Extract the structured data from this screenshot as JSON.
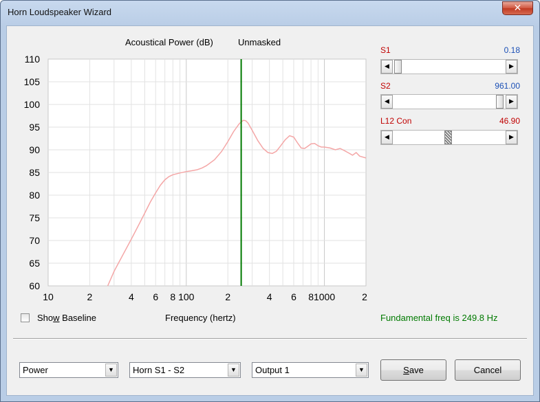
{
  "window": {
    "title": "Horn Loudspeaker Wizard",
    "close_glyph": "✕"
  },
  "chart_title": "Acoustical Power (dB)",
  "chart_mode": "Unmasked",
  "sliders": [
    {
      "label": "S1",
      "value": "0.18",
      "value_color": "#1a4fb5",
      "position": 0.02
    },
    {
      "label": "S2",
      "value": "961.00",
      "value_color": "#1a4fb5",
      "position": 0.98
    },
    {
      "label": "L12  Con",
      "value": "46.90",
      "value_color": "#c00000",
      "position": 0.47
    }
  ],
  "show_baseline": {
    "label_pre": "Sho",
    "label_underlined": "w",
    "label_post": " Baseline",
    "checked": false
  },
  "fundamental_text": "Fundamental freq is 249.8 Hz",
  "dropdowns": [
    {
      "name": "type",
      "selected": "Power"
    },
    {
      "name": "section",
      "selected": "Horn S1 - S2"
    },
    {
      "name": "output",
      "selected": "Output 1"
    }
  ],
  "buttons": {
    "save_pre": "",
    "save_underlined": "S",
    "save_post": "ave",
    "cancel": "Cancel"
  },
  "chart_data": {
    "type": "line",
    "title": "Acoustical Power (dB)   Unmasked",
    "xlabel": "Frequency (hertz)",
    "ylabel": "",
    "x_scale": "log",
    "xlim": [
      10,
      2000
    ],
    "ylim": [
      60,
      110
    ],
    "y_ticks": [
      110,
      105,
      100,
      95,
      90,
      85,
      80,
      75,
      70,
      65,
      60
    ],
    "x_ticks": [
      {
        "value": 10,
        "label": "10"
      },
      {
        "value": 20,
        "label": "2"
      },
      {
        "value": 40,
        "label": "4"
      },
      {
        "value": 60,
        "label": "6"
      },
      {
        "value": 80,
        "label": "8"
      },
      {
        "value": 100,
        "label": "100"
      },
      {
        "value": 200,
        "label": "2"
      },
      {
        "value": 400,
        "label": "4"
      },
      {
        "value": 600,
        "label": "6"
      },
      {
        "value": 800,
        "label": "8"
      },
      {
        "value": 1000,
        "label": "1000"
      },
      {
        "value": 2000,
        "label": "2"
      }
    ],
    "grid": true,
    "marker_frequency": 249.8,
    "marker_color": "#007a00",
    "series": [
      {
        "color": "#f4a6a6",
        "x": [
          27,
          30,
          35,
          40,
          45,
          50,
          55,
          60,
          65,
          70,
          75,
          80,
          90,
          100,
          110,
          120,
          130,
          140,
          160,
          180,
          200,
          220,
          240,
          250,
          260,
          270,
          280,
          300,
          330,
          360,
          390,
          420,
          450,
          480,
          520,
          560,
          600,
          640,
          680,
          720,
          760,
          800,
          850,
          900,
          950,
          1000,
          1100,
          1200,
          1300,
          1400,
          1500,
          1600,
          1700,
          1800,
          2000
        ],
        "y": [
          60,
          63.2,
          67,
          70.3,
          73.3,
          76,
          78.5,
          80.5,
          82.2,
          83.4,
          84.1,
          84.5,
          84.9,
          85.2,
          85.4,
          85.6,
          86,
          86.5,
          87.8,
          89.6,
          91.8,
          94,
          95.6,
          96.2,
          96.5,
          96.4,
          95.9,
          94.3,
          92,
          90.3,
          89.4,
          89.2,
          89.7,
          90.8,
          92.2,
          93.1,
          92.8,
          91.5,
          90.4,
          90.3,
          90.8,
          91.3,
          91.4,
          90.9,
          90.6,
          90.6,
          90.4,
          90,
          90.3,
          89.8,
          89.3,
          88.8,
          89.4,
          88.6,
          88.2
        ]
      }
    ]
  }
}
